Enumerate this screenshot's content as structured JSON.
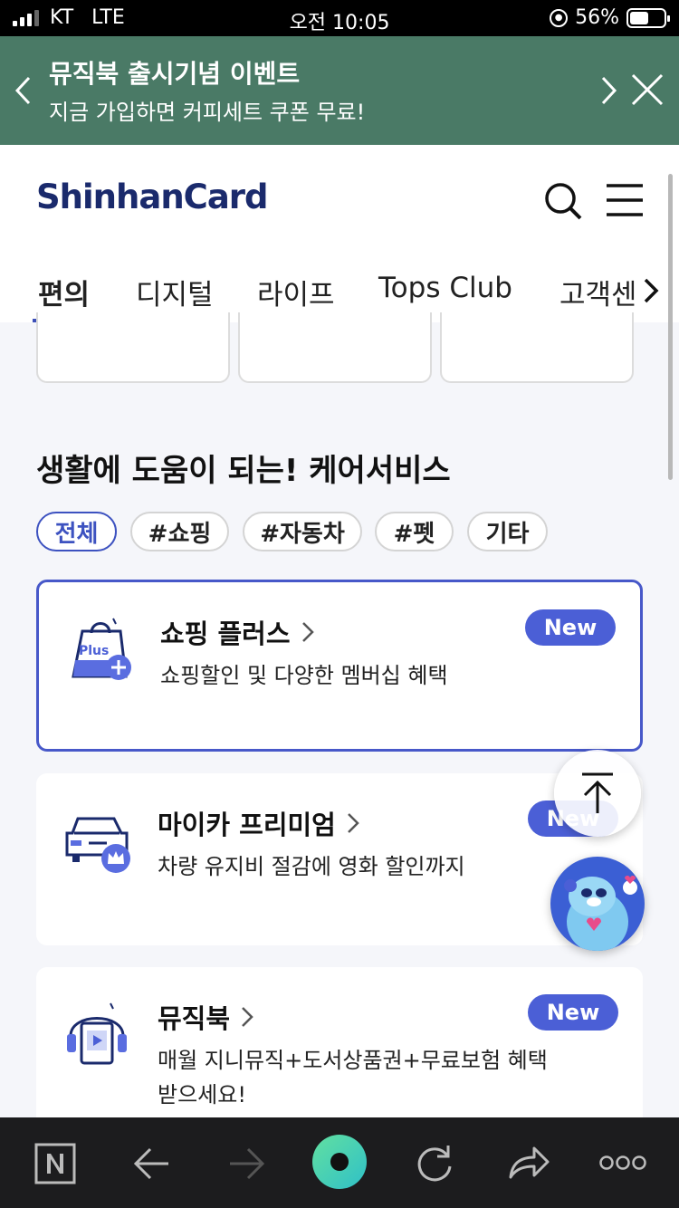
{
  "status_bar": {
    "carrier": "KT",
    "network": "LTE",
    "time": "오전 10:05",
    "battery": "56%",
    "battery_level": 0.56
  },
  "promo": {
    "title": "뮤직북 출시기념 이벤트",
    "subtitle": "지금 가입하면 커피세트 쿠폰 무료!"
  },
  "header": {
    "logo": "ShinhanCard"
  },
  "tabs": [
    {
      "label": "편의"
    },
    {
      "label": "디지털"
    },
    {
      "label": "라이프"
    },
    {
      "label": "Tops Club"
    },
    {
      "label": "고객센"
    }
  ],
  "section": {
    "title": "생활에 도움이 되는! 케어서비스",
    "filters": [
      {
        "label": "전체"
      },
      {
        "label": "#쇼핑"
      },
      {
        "label": "#자동차"
      },
      {
        "label": "#펫"
      },
      {
        "label": "기타"
      }
    ]
  },
  "services": [
    {
      "name": "쇼핑 플러스",
      "desc": "쇼핑할인 및 다양한 멤버십 혜택",
      "badge": "New",
      "icon": "shopping-bag-plus-icon",
      "icon_text": "Plus"
    },
    {
      "name": "마이카 프리미엄",
      "desc": "차량 유지비 절감에 영화 할인까지",
      "badge": "New",
      "icon": "car-crown-icon"
    },
    {
      "name": "뮤직북",
      "desc": "매월 지니뮤직+도서상품권+무료보험 혜택 받으세요!",
      "badge": "New",
      "icon": "headphone-book-icon"
    }
  ],
  "colors": {
    "promo_bg": "#4a7a66",
    "brand_navy": "#1a2a6c",
    "accent_blue": "#4b5fd6"
  }
}
